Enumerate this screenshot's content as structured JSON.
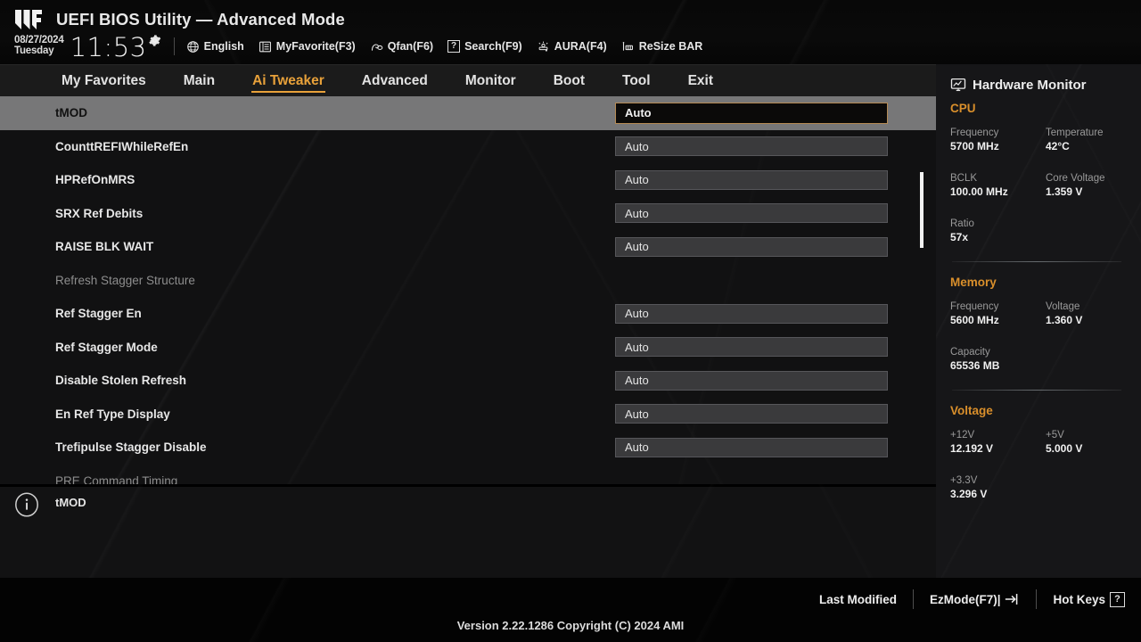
{
  "header": {
    "logo_icon": "tuf-logo",
    "title": "UEFI BIOS Utility — Advanced Mode",
    "date": "08/27/2024",
    "weekday": "Tuesday",
    "time": "11:53",
    "gear_icon": "gear-icon",
    "items": [
      {
        "icon": "globe-icon",
        "label": "English"
      },
      {
        "icon": "list-icon",
        "label": "MyFavorite(F3)"
      },
      {
        "icon": "fan-icon",
        "label": "Qfan(F6)"
      },
      {
        "icon": "question-box-icon",
        "label": "Search(F9)"
      },
      {
        "icon": "aura-light-icon",
        "label": "AURA(F4)"
      },
      {
        "icon": "resize-bar-icon",
        "label": "ReSize BAR"
      }
    ]
  },
  "menu": {
    "items": [
      {
        "label": "My Favorites",
        "active": false
      },
      {
        "label": "Main",
        "active": false
      },
      {
        "label": "Ai Tweaker",
        "active": true
      },
      {
        "label": "Advanced",
        "active": false
      },
      {
        "label": "Monitor",
        "active": false
      },
      {
        "label": "Boot",
        "active": false
      },
      {
        "label": "Tool",
        "active": false
      },
      {
        "label": "Exit",
        "active": false
      }
    ],
    "active_color": "#e8a13a"
  },
  "options": [
    {
      "label": "tMOD",
      "value": "Auto",
      "type": "setting",
      "selected": true
    },
    {
      "label": "CounttREFIWhileRefEn",
      "value": "Auto",
      "type": "setting",
      "selected": false
    },
    {
      "label": "HPRefOnMRS",
      "value": "Auto",
      "type": "setting",
      "selected": false
    },
    {
      "label": "SRX Ref Debits",
      "value": "Auto",
      "type": "setting",
      "selected": false
    },
    {
      "label": "RAISE BLK WAIT",
      "value": "Auto",
      "type": "setting",
      "selected": false
    },
    {
      "label": "Refresh Stagger Structure",
      "value": "",
      "type": "section",
      "selected": false
    },
    {
      "label": "Ref Stagger En",
      "value": "Auto",
      "type": "setting",
      "selected": false
    },
    {
      "label": "Ref Stagger Mode",
      "value": "Auto",
      "type": "setting",
      "selected": false
    },
    {
      "label": "Disable Stolen Refresh",
      "value": "Auto",
      "type": "setting",
      "selected": false
    },
    {
      "label": "En Ref Type Display",
      "value": "Auto",
      "type": "setting",
      "selected": false
    },
    {
      "label": "Trefipulse Stagger Disable",
      "value": "Auto",
      "type": "setting",
      "selected": false
    },
    {
      "label": "PRE Command Timing",
      "value": "",
      "type": "section",
      "selected": false
    }
  ],
  "help": {
    "icon": "info-icon",
    "text": "tMOD"
  },
  "hardware_monitor": {
    "icon": "monitor-icon",
    "title": "Hardware Monitor",
    "sections": [
      {
        "name": "CPU",
        "rows": [
          [
            {
              "key": "Frequency",
              "value": "5700 MHz"
            },
            {
              "key": "Temperature",
              "value": "42°C"
            }
          ],
          [
            {
              "key": "BCLK",
              "value": "100.00 MHz"
            },
            {
              "key": "Core Voltage",
              "value": "1.359 V"
            }
          ],
          [
            {
              "key": "Ratio",
              "value": "57x"
            }
          ]
        ]
      },
      {
        "name": "Memory",
        "rows": [
          [
            {
              "key": "Frequency",
              "value": "5600 MHz"
            },
            {
              "key": "Voltage",
              "value": "1.360 V"
            }
          ],
          [
            {
              "key": "Capacity",
              "value": "65536 MB"
            }
          ]
        ]
      },
      {
        "name": "Voltage",
        "rows": [
          [
            {
              "key": "+12V",
              "value": "12.192 V"
            },
            {
              "key": "+5V",
              "value": "5.000 V"
            }
          ],
          [
            {
              "key": "+3.3V",
              "value": "3.296 V"
            }
          ]
        ]
      }
    ],
    "section_color": "#d98f2b"
  },
  "bottom": {
    "last_modified": "Last Modified",
    "ezmode": "EzMode(F7)|",
    "ezmode_icon": "arrow-right-box-icon",
    "hotkeys": "Hot Keys",
    "hotkeys_icon": "question-box-icon",
    "version": "Version 2.22.1286 Copyright (C) 2024 AMI"
  }
}
